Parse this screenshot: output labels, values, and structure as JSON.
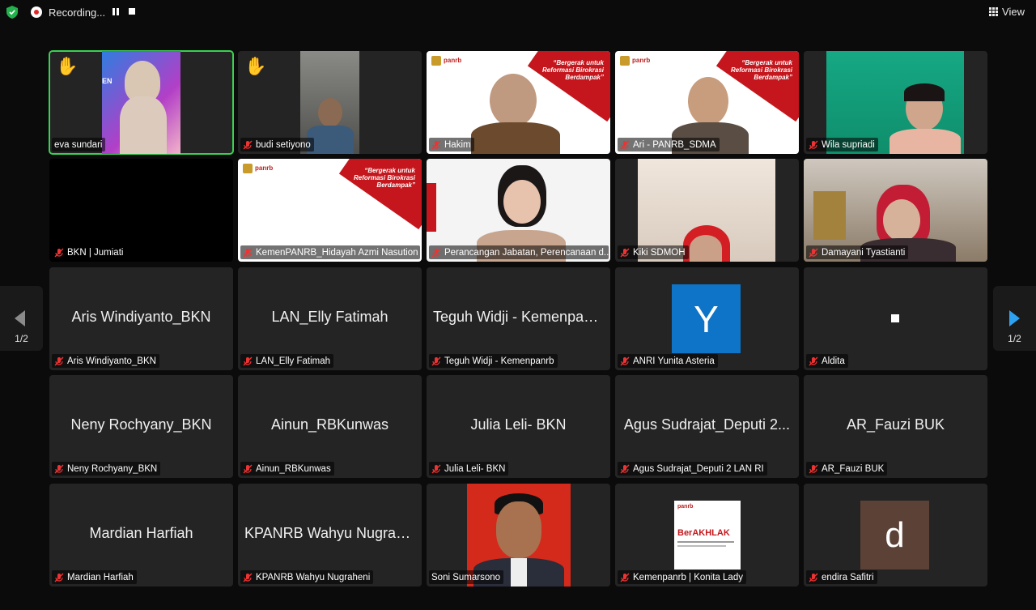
{
  "topbar": {
    "recording_label": "Recording...",
    "view_label": "View"
  },
  "pager": {
    "left_page": "1/2",
    "right_page": "1/2"
  },
  "colors": {
    "active_speaker": "#3ad151",
    "next_arrow": "#2ea2f2",
    "recording": "#e02828"
  },
  "slide": {
    "logo": "panrb",
    "tagline": "“Bergerak untuk Reformasi Birokrasi Berdampak”"
  },
  "participants": [
    {
      "name": "eva sundari",
      "video": true,
      "hand": true,
      "active": true
    },
    {
      "name": "budi setiyono",
      "video": true,
      "hand": true,
      "muted": true
    },
    {
      "name": "Hakim",
      "video": true,
      "muted": true
    },
    {
      "name": "Ari - PANRB_SDMA",
      "video": true,
      "muted": true
    },
    {
      "name": "Wila supriadi",
      "video": true,
      "muted": true
    },
    {
      "name": "BKN | Jumiati",
      "video": true,
      "muted": true
    },
    {
      "name": "KemenPANRB_Hidayah Azmi Nasution",
      "video": true,
      "muted": true
    },
    {
      "name": "Perancangan Jabatan, Perencanaan d...",
      "video": true,
      "muted": true
    },
    {
      "name": "Kiki SDMOH",
      "video": true,
      "muted": true
    },
    {
      "name": "Damayani Tyastianti",
      "video": true,
      "muted": true
    },
    {
      "name": "Aris Windiyanto_BKN",
      "display": "Aris Windiyanto_BKN",
      "muted": true
    },
    {
      "name": "LAN_Elly Fatimah",
      "display": "LAN_Elly Fatimah",
      "muted": true
    },
    {
      "name": "Teguh Widji - Kemenpanrb",
      "display": "Teguh Widji - Kemenpan...",
      "muted": true
    },
    {
      "name": "ANRI Yunita Asteria",
      "avatar": "Y",
      "muted": true
    },
    {
      "name": "Aldita",
      "muted": true
    },
    {
      "name": "Neny Rochyany_BKN",
      "display": "Neny Rochyany_BKN",
      "muted": true
    },
    {
      "name": "Ainun_RBKunwas",
      "display": "Ainun_RBKunwas",
      "muted": true
    },
    {
      "name": "Julia Leli- BKN",
      "display": "Julia Leli- BKN",
      "muted": true
    },
    {
      "name": "Agus Sudrajat_Deputi 2 LAN RI",
      "display": "Agus Sudrajat_Deputi 2...",
      "muted": true
    },
    {
      "name": "AR_Fauzi BUK",
      "display": "AR_Fauzi BUK",
      "muted": true
    },
    {
      "name": "Mardian Harfiah",
      "display": "Mardian Harfiah",
      "muted": true
    },
    {
      "name": "KPANRB Wahyu Nugraheni",
      "display": "KPANRB Wahyu Nugrah...",
      "muted": true
    },
    {
      "name": "Soni Sumarsono",
      "photo": true
    },
    {
      "name": "Kemenpanrb | Konita Lady",
      "logo": "BerAKHLAK",
      "muted": true
    },
    {
      "name": "endira Safitri",
      "avatar": "d",
      "muted": true
    }
  ]
}
